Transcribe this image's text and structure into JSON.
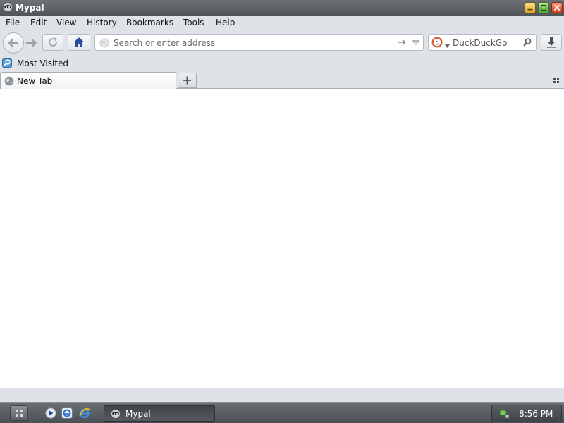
{
  "window": {
    "title": "Mypal",
    "app_icon": "mypal-raccoon-icon",
    "controls": [
      "minimize",
      "maximize",
      "close"
    ]
  },
  "menubar": {
    "items": [
      {
        "label": "File"
      },
      {
        "label": "Edit"
      },
      {
        "label": "View"
      },
      {
        "label": "History"
      },
      {
        "label": "Bookmarks"
      },
      {
        "label": "Tools"
      },
      {
        "label": "Help"
      }
    ]
  },
  "navbar": {
    "address_placeholder": "Search or enter address",
    "address_value": "",
    "search_engine": "DuckDuckGo",
    "search_placeholder": "DuckDuckGo",
    "search_value": ""
  },
  "bookmarks": {
    "items": [
      {
        "label": "Most Visited",
        "icon": "most-visited-icon"
      }
    ]
  },
  "tabs": {
    "items": [
      {
        "label": "New Tab",
        "icon": "globe-icon",
        "selected": true
      }
    ]
  },
  "taskbar": {
    "quick_launch": [
      "media-player-icon",
      "browser-icon",
      "internet-explorer-icon"
    ],
    "tasks": [
      {
        "label": "Mypal",
        "icon": "mypal-raccoon-icon"
      }
    ],
    "clock": "8:56 PM"
  },
  "colors": {
    "titlebar": "#5a5f64",
    "chrome": "#dfe3e7",
    "taskbar": "#5a5f64",
    "home_icon": "#2a4e9c"
  }
}
